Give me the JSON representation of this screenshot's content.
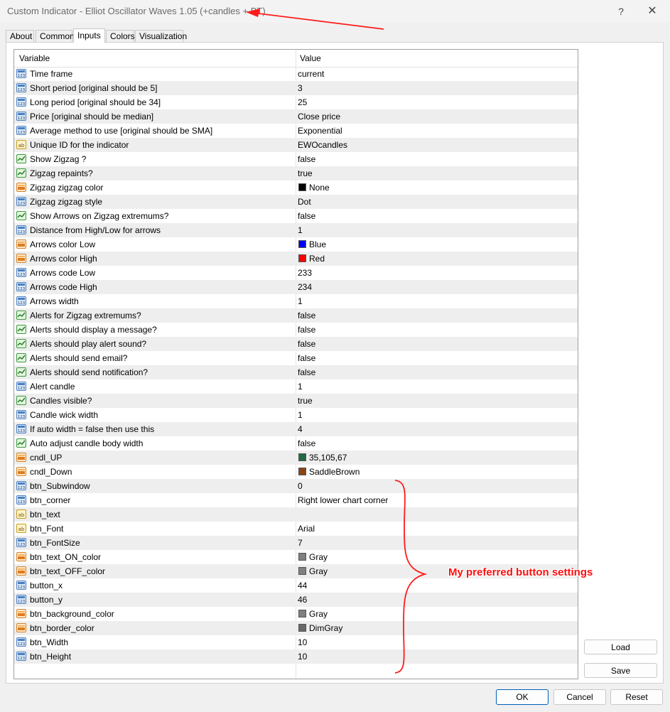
{
  "window": {
    "title": "Custom Indicator - Elliot Oscillator Waves 1.05 (+candles + BT)",
    "help_label": "?",
    "close_label": "✕"
  },
  "tabs": [
    {
      "label": "About"
    },
    {
      "label": "Common"
    },
    {
      "label": "Inputs",
      "active": true
    },
    {
      "label": "Colors"
    },
    {
      "label": "Visualization"
    }
  ],
  "grid": {
    "headers": {
      "variable": "Variable",
      "value": "Value"
    },
    "rows": [
      {
        "icon": "int-icon",
        "name": "Time frame",
        "value": "current"
      },
      {
        "icon": "int-icon",
        "name": "Short period [original should be 5]",
        "value": "3"
      },
      {
        "icon": "int-icon",
        "name": "Long period [original should be 34]",
        "value": "25"
      },
      {
        "icon": "int-icon",
        "name": "Price [original should be median]",
        "value": "Close price"
      },
      {
        "icon": "int-icon",
        "name": "Average method to use [original should be SMA]",
        "value": "Exponential"
      },
      {
        "icon": "string-icon",
        "name": "Unique ID for the indicator",
        "value": "EWOcandles"
      },
      {
        "icon": "bool-icon",
        "name": "Show   Zigzag ?",
        "value": "false"
      },
      {
        "icon": "bool-icon",
        "name": "Zigzag repaints?",
        "value": "true"
      },
      {
        "icon": "color-icon",
        "name": "Zigzag zigzag color",
        "value": "None",
        "swatch": "#000000"
      },
      {
        "icon": "int-icon",
        "name": "Zigzag zigzag style",
        "value": "Dot"
      },
      {
        "icon": "bool-icon",
        "name": "Show Arrows on Zigzag extremums?",
        "value": "false"
      },
      {
        "icon": "int-icon",
        "name": "Distance from High/Low for arrows",
        "value": "1"
      },
      {
        "icon": "color-icon",
        "name": "Arrows color Low",
        "value": "Blue",
        "swatch": "#0000ff"
      },
      {
        "icon": "color-icon",
        "name": "Arrows color High",
        "value": "Red",
        "swatch": "#ff0000"
      },
      {
        "icon": "int-icon",
        "name": "Arrows code Low",
        "value": "233"
      },
      {
        "icon": "int-icon",
        "name": "Arrows code High",
        "value": "234"
      },
      {
        "icon": "int-icon",
        "name": "Arrows width",
        "value": "1"
      },
      {
        "icon": "bool-icon",
        "name": "Alerts for Zigzag extremums?",
        "value": "false"
      },
      {
        "icon": "bool-icon",
        "name": "Alerts should display a message?",
        "value": "false"
      },
      {
        "icon": "bool-icon",
        "name": "Alerts should play alert sound?",
        "value": "false"
      },
      {
        "icon": "bool-icon",
        "name": "Alerts should send email?",
        "value": "false"
      },
      {
        "icon": "bool-icon",
        "name": "Alerts should send notification?",
        "value": "false"
      },
      {
        "icon": "int-icon",
        "name": "Alert candle",
        "value": "1"
      },
      {
        "icon": "bool-icon",
        "name": "Candles visible?",
        "value": "true"
      },
      {
        "icon": "int-icon",
        "name": "Candle wick width",
        "value": "1"
      },
      {
        "icon": "int-icon",
        "name": "If auto width = false then use this",
        "value": "4"
      },
      {
        "icon": "bool-icon",
        "name": "Auto adjust candle body width",
        "value": "false"
      },
      {
        "icon": "color-icon",
        "name": "cndl_UP",
        "value": "35,105,67",
        "swatch": "#236943"
      },
      {
        "icon": "color-icon",
        "name": "cndl_Down",
        "value": "SaddleBrown",
        "swatch": "#8b4513"
      },
      {
        "icon": "int-icon",
        "name": "btn_Subwindow",
        "value": "0"
      },
      {
        "icon": "int-icon",
        "name": "btn_corner",
        "value": "Right lower chart corner"
      },
      {
        "icon": "string-icon",
        "name": "btn_text",
        "value": ""
      },
      {
        "icon": "string-icon",
        "name": "btn_Font",
        "value": "Arial"
      },
      {
        "icon": "int-icon",
        "name": "btn_FontSize",
        "value": "7"
      },
      {
        "icon": "color-icon",
        "name": "btn_text_ON_color",
        "value": "Gray",
        "swatch": "#808080"
      },
      {
        "icon": "color-icon",
        "name": "btn_text_OFF_color",
        "value": "Gray",
        "swatch": "#808080"
      },
      {
        "icon": "int-icon",
        "name": "button_x",
        "value": "44"
      },
      {
        "icon": "int-icon",
        "name": "button_y",
        "value": "46"
      },
      {
        "icon": "color-icon",
        "name": "btn_background_color",
        "value": "Gray",
        "swatch": "#808080"
      },
      {
        "icon": "color-icon",
        "name": "btn_border_color",
        "value": "DimGray",
        "swatch": "#696969"
      },
      {
        "icon": "int-icon",
        "name": "btn_Width",
        "value": "10"
      },
      {
        "icon": "int-icon",
        "name": "btn_Height",
        "value": "10"
      }
    ]
  },
  "side_buttons": {
    "load": "Load",
    "save": "Save"
  },
  "bottom_buttons": {
    "ok": "OK",
    "cancel": "Cancel",
    "reset": "Reset"
  },
  "annotation": {
    "text": "My preferred button settings",
    "color": "#ff0d0d"
  },
  "colors": {
    "accent": "#005fb8",
    "row_alt": "#eeeeee",
    "annotation_red": "#ff0d0d"
  }
}
